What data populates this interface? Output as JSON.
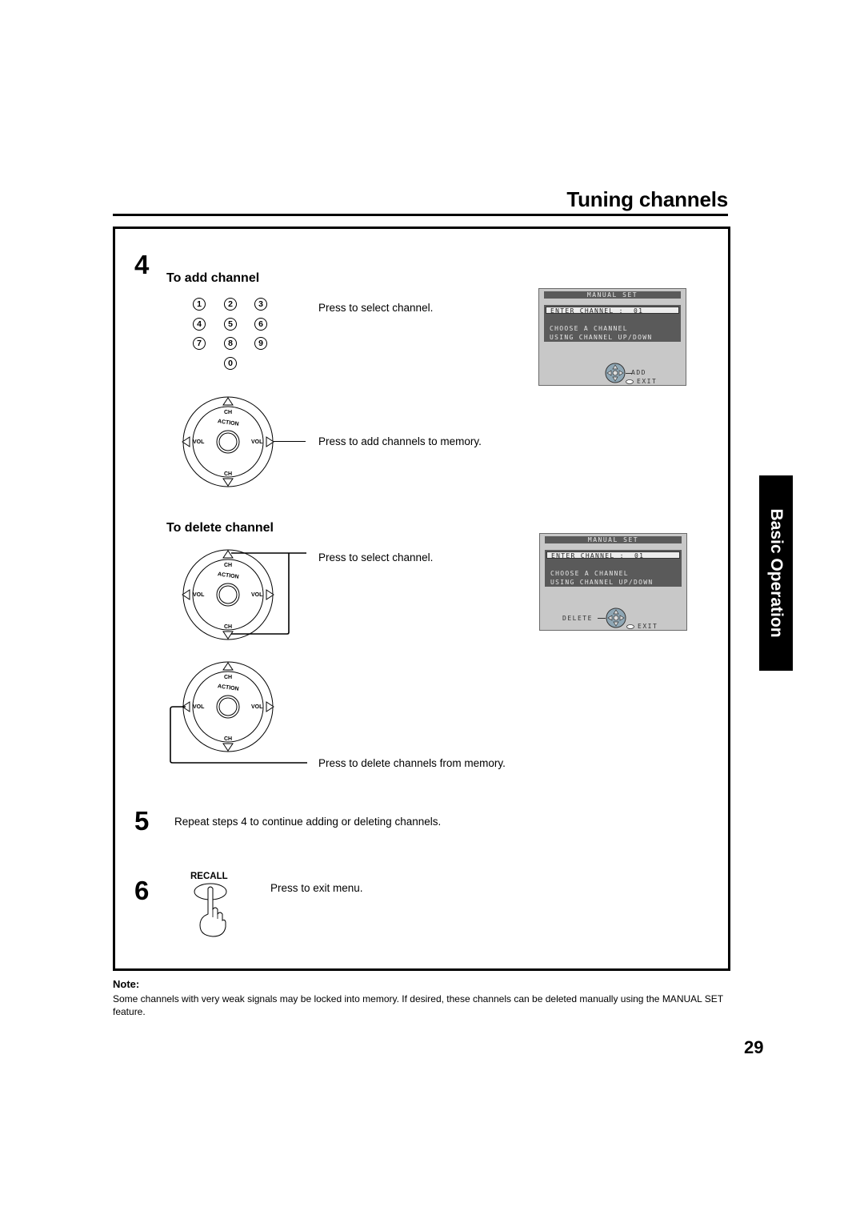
{
  "header": {
    "title": "Tuning channels"
  },
  "side_tab": {
    "label": "Basic Operation"
  },
  "steps": {
    "step4": {
      "number": "4",
      "add": {
        "heading": "To add channel",
        "keypad_keys": [
          "1",
          "2",
          "3",
          "4",
          "5",
          "6",
          "7",
          "8",
          "9",
          "0"
        ],
        "instruction_select": "Press to select channel.",
        "instruction_add": "Press to add channels to memory."
      },
      "delete": {
        "heading": "To delete channel",
        "instruction_select": "Press to select channel.",
        "instruction_delete": "Press to delete channels from memory."
      }
    },
    "step5": {
      "number": "5",
      "text": "Repeat steps 4 to continue adding or deleting channels."
    },
    "step6": {
      "number": "6",
      "button_label": "RECALL",
      "text": "Press to exit menu."
    }
  },
  "remote": {
    "ch": "CH",
    "vol": "VOL",
    "action": "ACTION"
  },
  "osd_add": {
    "header": "MANUAL SET",
    "enter_label": "ENTER CHANNEL :",
    "channel_value": "01",
    "line1": "CHOOSE A CHANNEL",
    "line2": "USING CHANNEL UP/DOWN",
    "action_label": "ADD",
    "exit_label": "EXIT"
  },
  "osd_delete": {
    "header": "MANUAL SET",
    "enter_label": "ENTER CHANNEL :",
    "channel_value": "01",
    "line1": "CHOOSE A CHANNEL",
    "line2": "USING CHANNEL UP/DOWN",
    "action_label": "DELETE",
    "exit_label": "EXIT"
  },
  "note": {
    "heading": "Note:",
    "text": "Some channels with very weak signals may be locked into memory. If desired, these channels can be deleted manually using the MANUAL SET feature."
  },
  "footer": {
    "page_number": "29"
  }
}
